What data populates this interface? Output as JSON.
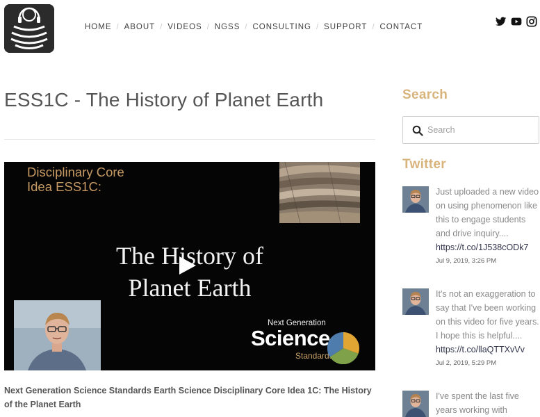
{
  "header": {
    "logo_alt": "Bozeman Science headphones logo",
    "nav": [
      "HOME",
      "ABOUT",
      "VIDEOS",
      "NGSS",
      "CONSULTING",
      "SUPPORT",
      "CONTACT"
    ],
    "social_icons": [
      "twitter-icon",
      "youtube-icon",
      "instagram-icon"
    ]
  },
  "main": {
    "title": "ESS1C - The History of Planet Earth",
    "video": {
      "kicker_line1": "Disciplinary Core",
      "kicker_line2": "Idea ESS1C:",
      "heading_line1": "The History of",
      "heading_line2": "Planet Earth",
      "badge_small": "Next Generation",
      "badge_big": "Science",
      "badge_standards": "Standards"
    },
    "caption": "Next Generation Science Standards Earth Science Disciplinary Core Idea 1C:  The History of the Planet Earth"
  },
  "sidebar": {
    "search_title": "Search",
    "search_placeholder": "Search",
    "twitter_title": "Twitter",
    "tweets": [
      {
        "text": "Just uploaded a new video on using phenomenon like this to engage students and drive inquiry....",
        "link": "https://t.co/1J538cODk7",
        "date": "Jul 9, 2019, 3:26 PM"
      },
      {
        "text": "It's not an exaggeration to say that I've been working on this video for five years. I hope this is helpful....",
        "link": "https://t.co/llaQTTXvVv",
        "date": "Jul 2, 2019, 5:29 PM"
      },
      {
        "text": "I've spent the last five years working with",
        "link": "",
        "date": ""
      }
    ]
  },
  "colors": {
    "accent": "#d8b47c",
    "video_kicker": "#c79a63",
    "link": "#30334a"
  }
}
